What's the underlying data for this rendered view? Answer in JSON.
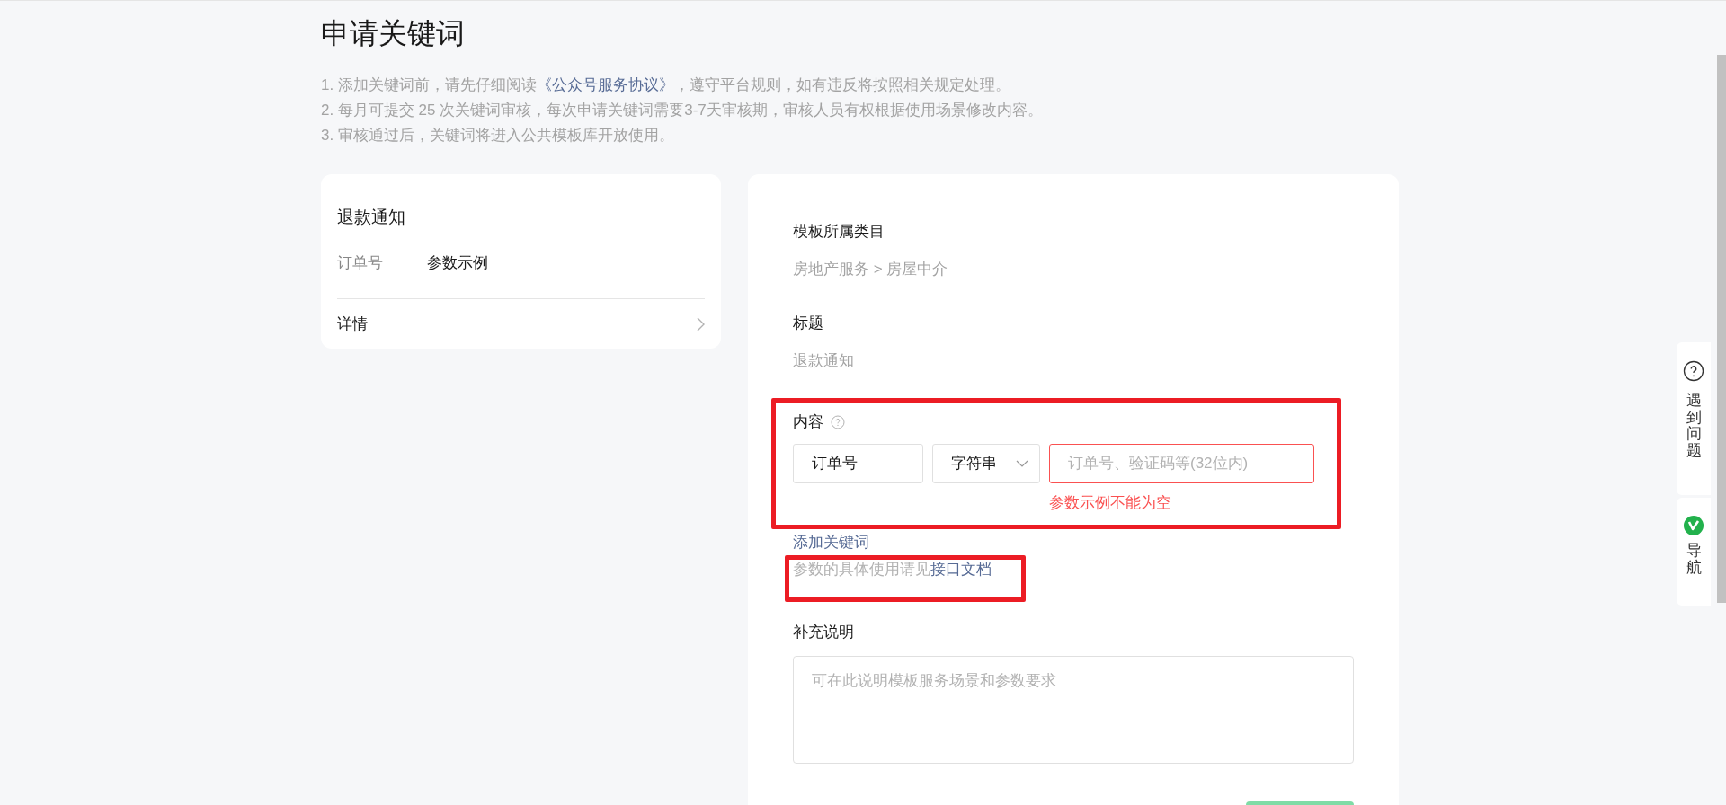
{
  "page_title": "申请关键词",
  "notes": [
    {
      "before": "1. 添加关键词前，请先仔细阅读",
      "link": "《公众号服务协议》",
      "after": "，遵守平台规则，如有违反将按照相关规定处理。"
    },
    {
      "before": "2. 每月可提交 25 次关键词审核，每次申请关键词需要3-7天审核期，审核人员有权根据使用场景修改内容。"
    },
    {
      "before": "3. 审核通过后，关键词将进入公共模板库开放使用。"
    }
  ],
  "preview": {
    "title": "退款通知",
    "fields": [
      {
        "label": "订单号",
        "value": "参数示例"
      }
    ],
    "detail_label": "详情"
  },
  "form": {
    "category": {
      "label": "模板所属类目",
      "value": "房地产服务 > 房屋中介"
    },
    "title": {
      "label": "标题",
      "value": "退款通知"
    },
    "content": {
      "label": "内容",
      "keywords": [
        {
          "name": "订单号",
          "type": "字符串",
          "example_placeholder": "订单号、验证码等(32位内)",
          "invalid": true,
          "error": "参数示例不能为空"
        }
      ],
      "add_keyword": "添加关键词",
      "help_text": "参数的具体使用请见",
      "help_link": "接口文档"
    },
    "remarks": {
      "label": "补充说明",
      "placeholder": "可在此说明模板服务场景和参数要求"
    }
  },
  "side_widget": [
    {
      "kind": "help",
      "label": "遇到问题"
    },
    {
      "kind": "nav",
      "label": "导航"
    }
  ]
}
